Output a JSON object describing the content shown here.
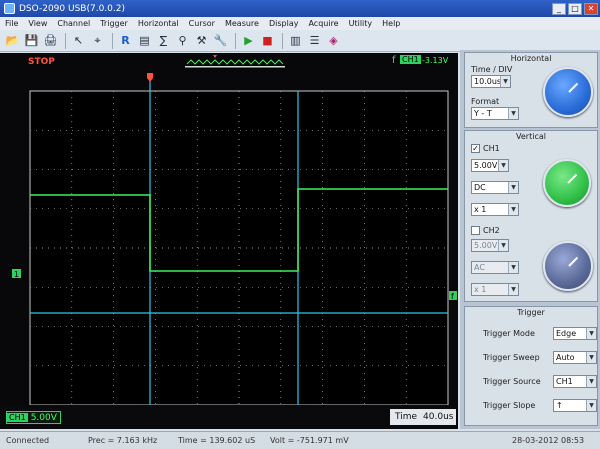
{
  "window": {
    "title": "DSO-2090 USB(7.0.0.2)",
    "min_label": "_",
    "max_label": "□",
    "close_label": "✕"
  },
  "menu": {
    "items": [
      "File",
      "View",
      "Channel",
      "Trigger",
      "Horizontal",
      "Cursor",
      "Measure",
      "Display",
      "Acquire",
      "Utility",
      "Help"
    ]
  },
  "toolbar": {
    "icons": [
      "open-icon",
      "save-icon",
      "print-icon",
      "select-arrow-icon",
      "cursor-icon",
      "reference-icon",
      "fft-icon",
      "math-icon",
      "zoom-icon",
      "probe-icon",
      "tools-icon",
      "run-icon",
      "stop-icon",
      "display-icon",
      "settings-icon",
      "record-icon"
    ]
  },
  "scope": {
    "run_state": "STOP",
    "trigger_glyph": "f",
    "trigger_channel": "CH1",
    "trigger_level": "-3.13V",
    "ch1_label": "1",
    "ch1_scale": "5.00V",
    "time_label": "Time",
    "time_value": "40.0us"
  },
  "horizontal": {
    "title": "Horizontal",
    "time_div_label": "Time / DIV",
    "time_div_value": "10.0us",
    "format_label": "Format",
    "format_value": "Y - T"
  },
  "vertical": {
    "title": "Vertical",
    "ch1": {
      "label": "CH1",
      "checked": true,
      "volts": "5.00V",
      "coupling": "DC",
      "probe": "x 1"
    },
    "ch2": {
      "label": "CH2",
      "checked": false,
      "volts": "5.00V",
      "coupling": "AC",
      "probe": "x 1"
    }
  },
  "trigger": {
    "title": "Trigger",
    "rows": [
      {
        "label": "Trigger Mode",
        "value": "Edge"
      },
      {
        "label": "Trigger Sweep",
        "value": "Auto"
      },
      {
        "label": "Trigger Source",
        "value": "CH1"
      },
      {
        "label": "Trigger Slope",
        "value": "↑"
      }
    ]
  },
  "status": {
    "connection": "Connected",
    "frequency": "Prec = 7.163 kHz",
    "time": "Time = 139.602 uS",
    "voltage": "Volt = -751.971 mV",
    "datetime": "28-03-2012 08:53"
  },
  "colors": {
    "trace_ch1": "#3cf05a",
    "cursor": "#2ec8e6",
    "grid": "#c8c8c8",
    "knob_horizontal": "#2a6cd8",
    "knob_ch1": "#30c048",
    "knob_ch2": "#5a6a98"
  }
}
